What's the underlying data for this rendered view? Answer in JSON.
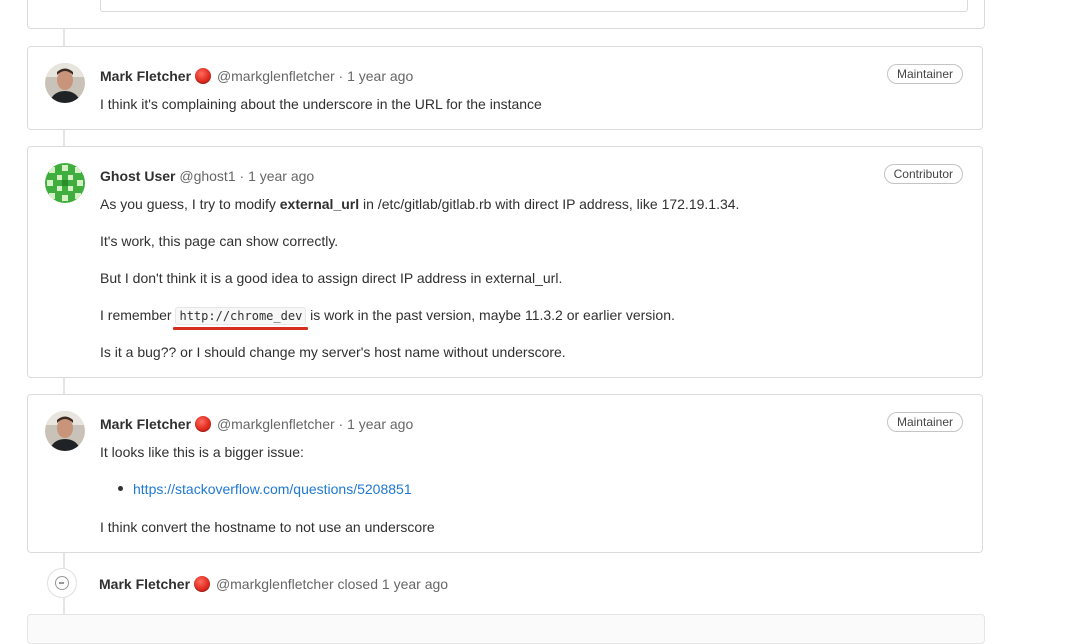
{
  "notes": [
    {
      "author": "Mark Fletcher",
      "username": "@markglenfletcher",
      "time": "1 year ago",
      "role": "Maintainer",
      "paragraphs": [
        "I think it's complaining about the underscore in the URL for the instance"
      ]
    },
    {
      "author": "Ghost User",
      "username": "@ghost1",
      "time": "1 year ago",
      "role": "Contributor",
      "line1_pre": "As you guess, I try to modify ",
      "line1_bold": "external_url",
      "line1_post": " in /etc/gitlab/gitlab.rb with direct IP address, like 172.19.1.34.",
      "line2": "It's work, this page can show correctly.",
      "line3": "But I don't think it is a good idea to assign direct IP address in external_url.",
      "line4_pre": "I remember ",
      "line4_code": "http://chrome_dev",
      "line4_post": " is work in the past version, maybe 11.3.2 or earlier version.",
      "line5": "Is it a bug?? or I should change my server's host name without underscore."
    },
    {
      "author": "Mark Fletcher",
      "username": "@markglenfletcher",
      "time": "1 year ago",
      "role": "Maintainer",
      "intro": "It looks like this is a bigger issue:",
      "link": "https://stackoverflow.com/questions/5208851",
      "outro": "I think convert the hostname to not use an underscore"
    }
  ],
  "system_note": {
    "author": "Mark Fletcher",
    "username": "@markglenfletcher",
    "action": "closed",
    "time": "1 year ago"
  },
  "separator": "·",
  "colors": {
    "link": "#1f78d1",
    "status": "#e02b20",
    "highlight": "#d62d20"
  }
}
